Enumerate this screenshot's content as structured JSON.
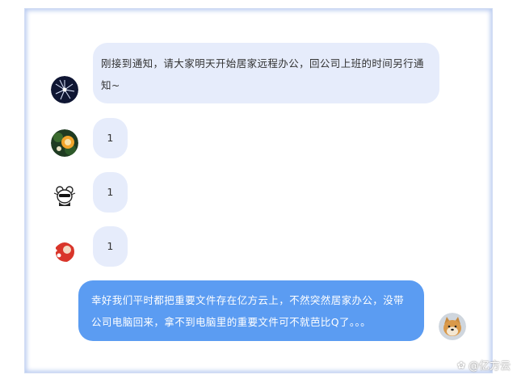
{
  "messages": [
    {
      "id": "m1",
      "side": "left",
      "text": "刚接到通知，请大家明天开始居家远程办公，回公司上班的时间另行通知~",
      "avatar": "fireworks-avatar"
    },
    {
      "id": "m2",
      "side": "left",
      "text": "1",
      "avatar": "orange-character-avatar"
    },
    {
      "id": "m3",
      "side": "left",
      "text": "1",
      "avatar": "cartoon-bear-avatar"
    },
    {
      "id": "m4",
      "side": "left",
      "text": "1",
      "avatar": "red-character-avatar"
    },
    {
      "id": "m5",
      "side": "right",
      "text": "幸好我们平时都把重要文件存在亿方云上，不然突然居家办公，没带公司电脑回来，拿不到电脑里的重要文件可不就芭比Q了。。。",
      "avatar": "shiba-dog-avatar"
    }
  ],
  "watermark": {
    "text": "@亿方云",
    "icon": "weibo-icon"
  },
  "colors": {
    "incoming_bubble": "#e6ecfb",
    "outgoing_bubble": "#5b9cf2",
    "frame_border": "#b9cbf1"
  }
}
